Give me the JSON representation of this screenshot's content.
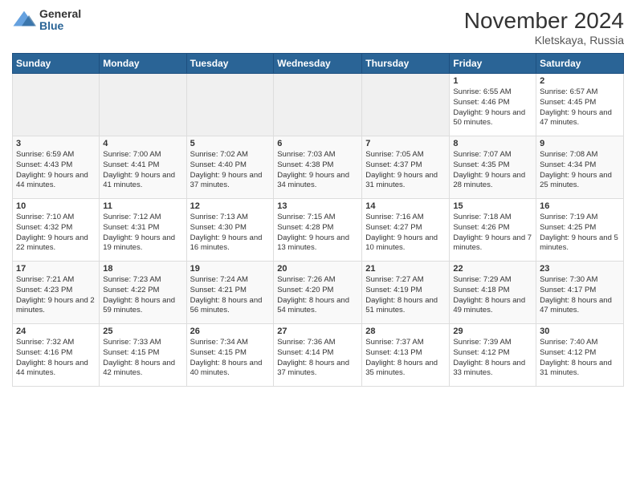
{
  "logo": {
    "general": "General",
    "blue": "Blue"
  },
  "title": "November 2024",
  "location": "Kletskaya, Russia",
  "days_of_week": [
    "Sunday",
    "Monday",
    "Tuesday",
    "Wednesday",
    "Thursday",
    "Friday",
    "Saturday"
  ],
  "weeks": [
    [
      {
        "day": "",
        "sunrise": "",
        "sunset": "",
        "daylight": ""
      },
      {
        "day": "",
        "sunrise": "",
        "sunset": "",
        "daylight": ""
      },
      {
        "day": "",
        "sunrise": "",
        "sunset": "",
        "daylight": ""
      },
      {
        "day": "",
        "sunrise": "",
        "sunset": "",
        "daylight": ""
      },
      {
        "day": "",
        "sunrise": "",
        "sunset": "",
        "daylight": ""
      },
      {
        "day": "1",
        "sunrise": "Sunrise: 6:55 AM",
        "sunset": "Sunset: 4:46 PM",
        "daylight": "Daylight: 9 hours and 50 minutes."
      },
      {
        "day": "2",
        "sunrise": "Sunrise: 6:57 AM",
        "sunset": "Sunset: 4:45 PM",
        "daylight": "Daylight: 9 hours and 47 minutes."
      }
    ],
    [
      {
        "day": "3",
        "sunrise": "Sunrise: 6:59 AM",
        "sunset": "Sunset: 4:43 PM",
        "daylight": "Daylight: 9 hours and 44 minutes."
      },
      {
        "day": "4",
        "sunrise": "Sunrise: 7:00 AM",
        "sunset": "Sunset: 4:41 PM",
        "daylight": "Daylight: 9 hours and 41 minutes."
      },
      {
        "day": "5",
        "sunrise": "Sunrise: 7:02 AM",
        "sunset": "Sunset: 4:40 PM",
        "daylight": "Daylight: 9 hours and 37 minutes."
      },
      {
        "day": "6",
        "sunrise": "Sunrise: 7:03 AM",
        "sunset": "Sunset: 4:38 PM",
        "daylight": "Daylight: 9 hours and 34 minutes."
      },
      {
        "day": "7",
        "sunrise": "Sunrise: 7:05 AM",
        "sunset": "Sunset: 4:37 PM",
        "daylight": "Daylight: 9 hours and 31 minutes."
      },
      {
        "day": "8",
        "sunrise": "Sunrise: 7:07 AM",
        "sunset": "Sunset: 4:35 PM",
        "daylight": "Daylight: 9 hours and 28 minutes."
      },
      {
        "day": "9",
        "sunrise": "Sunrise: 7:08 AM",
        "sunset": "Sunset: 4:34 PM",
        "daylight": "Daylight: 9 hours and 25 minutes."
      }
    ],
    [
      {
        "day": "10",
        "sunrise": "Sunrise: 7:10 AM",
        "sunset": "Sunset: 4:32 PM",
        "daylight": "Daylight: 9 hours and 22 minutes."
      },
      {
        "day": "11",
        "sunrise": "Sunrise: 7:12 AM",
        "sunset": "Sunset: 4:31 PM",
        "daylight": "Daylight: 9 hours and 19 minutes."
      },
      {
        "day": "12",
        "sunrise": "Sunrise: 7:13 AM",
        "sunset": "Sunset: 4:30 PM",
        "daylight": "Daylight: 9 hours and 16 minutes."
      },
      {
        "day": "13",
        "sunrise": "Sunrise: 7:15 AM",
        "sunset": "Sunset: 4:28 PM",
        "daylight": "Daylight: 9 hours and 13 minutes."
      },
      {
        "day": "14",
        "sunrise": "Sunrise: 7:16 AM",
        "sunset": "Sunset: 4:27 PM",
        "daylight": "Daylight: 9 hours and 10 minutes."
      },
      {
        "day": "15",
        "sunrise": "Sunrise: 7:18 AM",
        "sunset": "Sunset: 4:26 PM",
        "daylight": "Daylight: 9 hours and 7 minutes."
      },
      {
        "day": "16",
        "sunrise": "Sunrise: 7:19 AM",
        "sunset": "Sunset: 4:25 PM",
        "daylight": "Daylight: 9 hours and 5 minutes."
      }
    ],
    [
      {
        "day": "17",
        "sunrise": "Sunrise: 7:21 AM",
        "sunset": "Sunset: 4:23 PM",
        "daylight": "Daylight: 9 hours and 2 minutes."
      },
      {
        "day": "18",
        "sunrise": "Sunrise: 7:23 AM",
        "sunset": "Sunset: 4:22 PM",
        "daylight": "Daylight: 8 hours and 59 minutes."
      },
      {
        "day": "19",
        "sunrise": "Sunrise: 7:24 AM",
        "sunset": "Sunset: 4:21 PM",
        "daylight": "Daylight: 8 hours and 56 minutes."
      },
      {
        "day": "20",
        "sunrise": "Sunrise: 7:26 AM",
        "sunset": "Sunset: 4:20 PM",
        "daylight": "Daylight: 8 hours and 54 minutes."
      },
      {
        "day": "21",
        "sunrise": "Sunrise: 7:27 AM",
        "sunset": "Sunset: 4:19 PM",
        "daylight": "Daylight: 8 hours and 51 minutes."
      },
      {
        "day": "22",
        "sunrise": "Sunrise: 7:29 AM",
        "sunset": "Sunset: 4:18 PM",
        "daylight": "Daylight: 8 hours and 49 minutes."
      },
      {
        "day": "23",
        "sunrise": "Sunrise: 7:30 AM",
        "sunset": "Sunset: 4:17 PM",
        "daylight": "Daylight: 8 hours and 47 minutes."
      }
    ],
    [
      {
        "day": "24",
        "sunrise": "Sunrise: 7:32 AM",
        "sunset": "Sunset: 4:16 PM",
        "daylight": "Daylight: 8 hours and 44 minutes."
      },
      {
        "day": "25",
        "sunrise": "Sunrise: 7:33 AM",
        "sunset": "Sunset: 4:15 PM",
        "daylight": "Daylight: 8 hours and 42 minutes."
      },
      {
        "day": "26",
        "sunrise": "Sunrise: 7:34 AM",
        "sunset": "Sunset: 4:15 PM",
        "daylight": "Daylight: 8 hours and 40 minutes."
      },
      {
        "day": "27",
        "sunrise": "Sunrise: 7:36 AM",
        "sunset": "Sunset: 4:14 PM",
        "daylight": "Daylight: 8 hours and 37 minutes."
      },
      {
        "day": "28",
        "sunrise": "Sunrise: 7:37 AM",
        "sunset": "Sunset: 4:13 PM",
        "daylight": "Daylight: 8 hours and 35 minutes."
      },
      {
        "day": "29",
        "sunrise": "Sunrise: 7:39 AM",
        "sunset": "Sunset: 4:12 PM",
        "daylight": "Daylight: 8 hours and 33 minutes."
      },
      {
        "day": "30",
        "sunrise": "Sunrise: 7:40 AM",
        "sunset": "Sunset: 4:12 PM",
        "daylight": "Daylight: 8 hours and 31 minutes."
      }
    ]
  ]
}
